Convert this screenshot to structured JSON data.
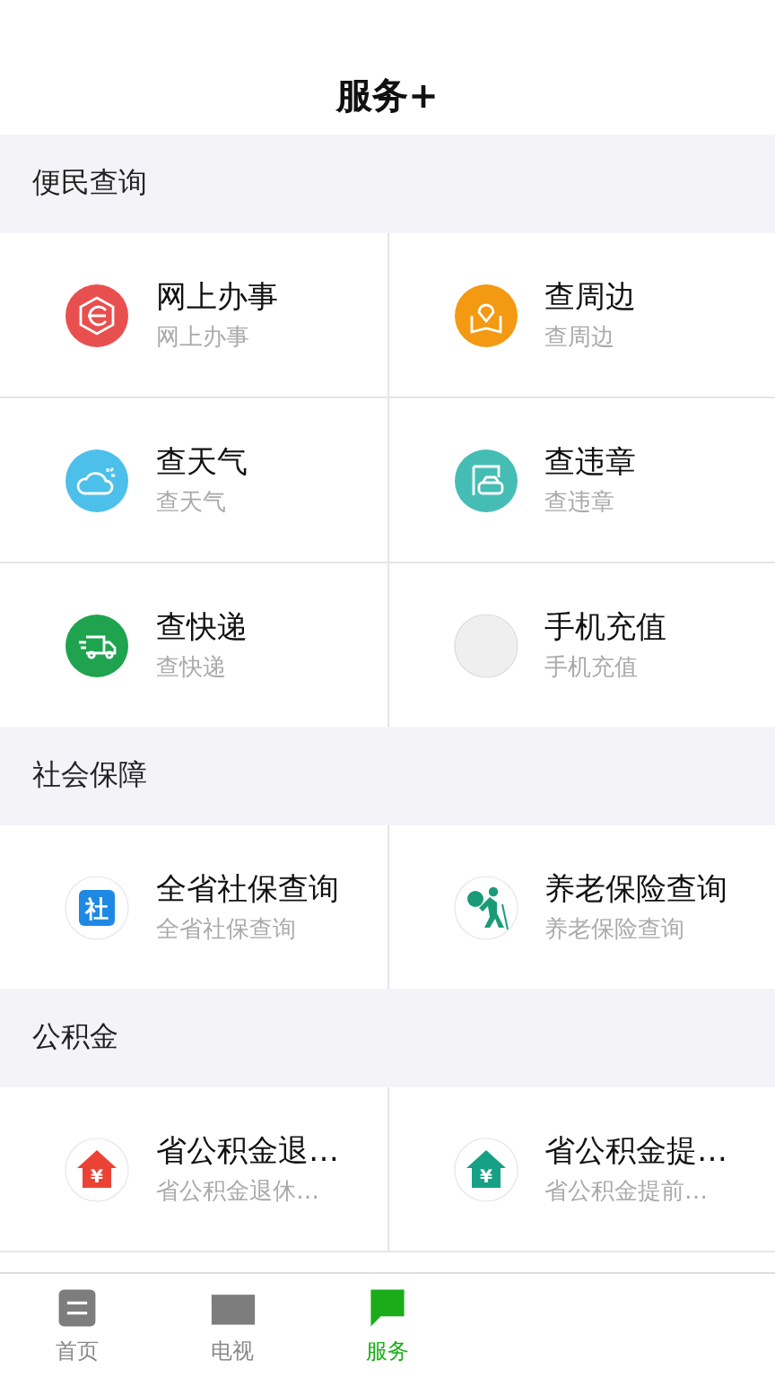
{
  "header": {
    "title": "服务+"
  },
  "sections": [
    {
      "title": "便民查询",
      "items": [
        {
          "kind": "web",
          "color": "#e8504f",
          "title": "网上办事",
          "subtitle": "网上办事"
        },
        {
          "kind": "map",
          "color": "#f39a12",
          "title": "查周边",
          "subtitle": "查周边"
        },
        {
          "kind": "weather",
          "color": "#4cc0ea",
          "title": "查天气",
          "subtitle": "查天气"
        },
        {
          "kind": "car",
          "color": "#45bdb5",
          "title": "查违章",
          "subtitle": "查违章"
        },
        {
          "kind": "truck",
          "color": "#1fa34f",
          "title": "查快递",
          "subtitle": "查快递"
        },
        {
          "kind": "blank",
          "color": "#efefef",
          "title": "手机充值",
          "subtitle": "手机充值"
        }
      ]
    },
    {
      "title": "社会保障",
      "items": [
        {
          "kind": "badge",
          "color": "#1e88e5",
          "icon_text": "社",
          "title": "全省社保查询",
          "subtitle": "全省社保查询"
        },
        {
          "kind": "elder",
          "color": "#1a9b77",
          "title": "养老保险查询",
          "subtitle": "养老保险查询"
        }
      ]
    },
    {
      "title": "公积金",
      "items": [
        {
          "kind": "house",
          "color": "#ea4335",
          "icon_text": "¥",
          "title": "省公积金退…",
          "subtitle": "省公积金退休…"
        },
        {
          "kind": "house",
          "color": "#17a085",
          "icon_text": "¥",
          "title": "省公积金提…",
          "subtitle": "省公积金提前…"
        }
      ]
    }
  ],
  "tabs": [
    {
      "kind": "home",
      "label": "首页",
      "selected": false
    },
    {
      "kind": "tv",
      "label": "电视",
      "selected": false
    },
    {
      "kind": "service",
      "label": "服务",
      "selected": true
    }
  ]
}
